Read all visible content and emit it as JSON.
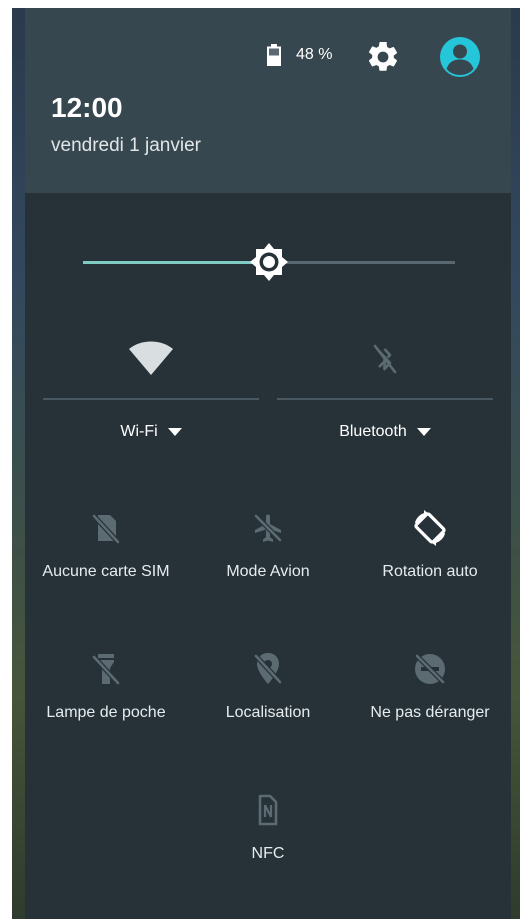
{
  "status": {
    "battery_percent": "48 %",
    "battery_icon": "battery-icon",
    "settings_icon": "gear-icon",
    "user_icon": "account-circle-icon"
  },
  "header": {
    "time": "12:00",
    "date": "vendredi 1 janvier"
  },
  "brightness": {
    "level": 0.5,
    "icon": "brightness-icon"
  },
  "big_tiles": [
    {
      "label": "Wi-Fi",
      "icon": "wifi-icon"
    },
    {
      "label": "Bluetooth",
      "icon": "bluetooth-disabled-icon"
    }
  ],
  "tiles": [
    {
      "label": "Aucune carte SIM",
      "icon": "no-sim-icon"
    },
    {
      "label": "Mode Avion",
      "icon": "airplane-icon"
    },
    {
      "label": "Rotation auto",
      "icon": "screen-rotation-icon"
    },
    {
      "label": "Lampe de poche",
      "icon": "flashlight-off-icon"
    },
    {
      "label": "Localisation",
      "icon": "location-off-icon"
    },
    {
      "label": "Ne pas déranger",
      "icon": "do-not-disturb-icon"
    },
    {
      "label": "NFC",
      "icon": "nfc-icon"
    }
  ],
  "colors": {
    "panel": "#263238",
    "header": "#37474f",
    "accent": "#80cbc4",
    "avatar": "#26c6da",
    "icon_dim": "#5c6b72"
  }
}
